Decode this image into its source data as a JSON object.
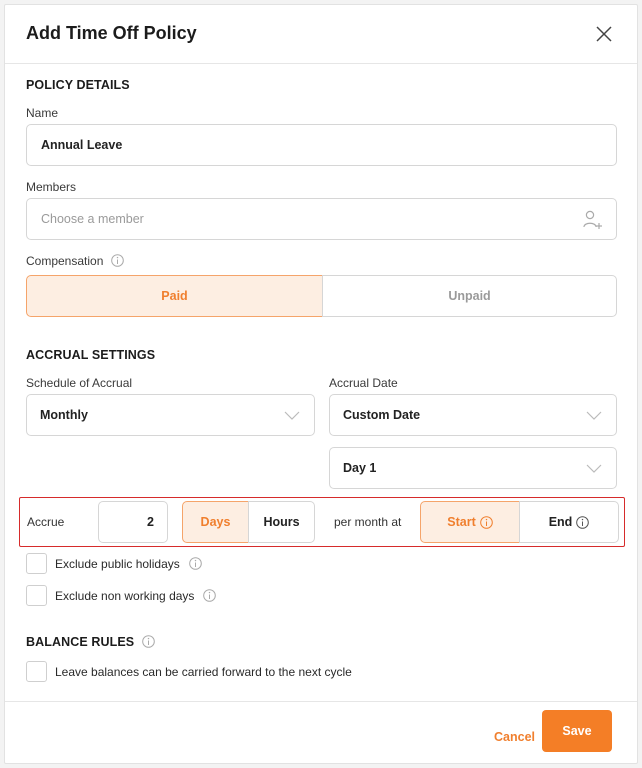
{
  "modal": {
    "title": "Add Time Off Policy"
  },
  "policy_details": {
    "heading": "POLICY DETAILS",
    "name_label": "Name",
    "name_value": "Annual Leave",
    "members_label": "Members",
    "members_placeholder": "Choose a member",
    "compensation_label": "Compensation",
    "compensation_options": [
      "Paid",
      "Unpaid"
    ],
    "compensation_selected": "Paid"
  },
  "accrual_settings": {
    "heading": "ACCRUAL SETTINGS",
    "schedule_label": "Schedule of Accrual",
    "schedule_value": "Monthly",
    "date_label": "Accrual Date",
    "date_value": "Custom Date",
    "day_value": "Day 1",
    "accrue_label": "Accrue",
    "accrue_amount": "2",
    "unit_options": [
      "Days",
      "Hours"
    ],
    "unit_selected": "Days",
    "per_month_text": "per month at",
    "timing_options": [
      "Start",
      "End"
    ],
    "timing_selected": "Start",
    "exclude_public_holidays": "Exclude public holidays",
    "exclude_non_working_days": "Exclude non working days"
  },
  "balance_rules": {
    "heading": "BALANCE RULES",
    "carry_forward": "Leave balances can be carried forward to the next cycle"
  },
  "footer": {
    "cancel_label": "Cancel",
    "save_label": "Save"
  },
  "colors": {
    "accent": "#f47e26",
    "accent_light": "#fdeee2",
    "highlight_border": "#d62b2b"
  }
}
